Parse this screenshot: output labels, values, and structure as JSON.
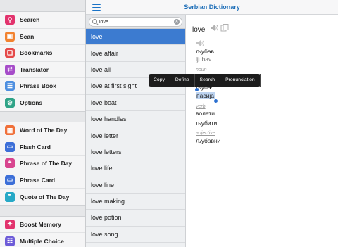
{
  "header": {
    "title": "Serbian Dictionary",
    "menu_icon": "hamburger-icon"
  },
  "sidebar": {
    "groups": [
      {
        "items": [
          {
            "label": "Search",
            "icon": "search-icon",
            "color": "#e2336d"
          },
          {
            "label": "Scan",
            "icon": "scan-icon",
            "color": "#f2822f"
          },
          {
            "label": "Bookmarks",
            "icon": "bookmark-icon",
            "color": "#e54a4a"
          },
          {
            "label": "Translator",
            "icon": "translator-icon",
            "color": "#a64cc9"
          },
          {
            "label": "Phrase Book",
            "icon": "phrasebook-icon",
            "color": "#4e8fe0"
          },
          {
            "label": "Options",
            "icon": "gear-icon",
            "color": "#2fa387"
          }
        ]
      },
      {
        "items": [
          {
            "label": "Word of The Day",
            "icon": "calendar-icon",
            "color": "#f0703a"
          },
          {
            "label": "Flash Card",
            "icon": "flashcard-icon",
            "color": "#3d6fd8"
          },
          {
            "label": "Phrase of The Day",
            "icon": "phrase-icon",
            "color": "#d8458f"
          },
          {
            "label": "Phrase Card",
            "icon": "phrasecard-icon",
            "color": "#3d6fd8"
          },
          {
            "label": "Quote of The Day",
            "icon": "quote-icon",
            "color": "#27a9c7"
          }
        ]
      },
      {
        "items": [
          {
            "label": "Boost Memory",
            "icon": "brain-icon",
            "color": "#e2336d"
          },
          {
            "label": "Multiple Choice",
            "icon": "choice-icon",
            "color": "#6d5bd8"
          }
        ]
      }
    ]
  },
  "search": {
    "value": "love",
    "placeholder": ""
  },
  "word_list": {
    "active_index": 0,
    "items": [
      "love",
      "love affair",
      "love all",
      "love at first sight",
      "love boat",
      "love handles",
      "love letter",
      "love letters",
      "love life",
      "love line",
      "love making",
      "love potion",
      "love song"
    ]
  },
  "definition": {
    "headword": "love",
    "noun_label": "noun",
    "verb_label": "verb",
    "adjective_label": "adjective",
    "entries": {
      "first": "љубав",
      "first_translit": "ljubav",
      "noun1": "љуба",
      "noun2": "пасија",
      "verb1": "волети",
      "verb2": "љубити",
      "adj1": "љубавни"
    }
  },
  "context_menu": {
    "items": [
      "Copy",
      "Define",
      "Search",
      "Pronunciation"
    ]
  }
}
